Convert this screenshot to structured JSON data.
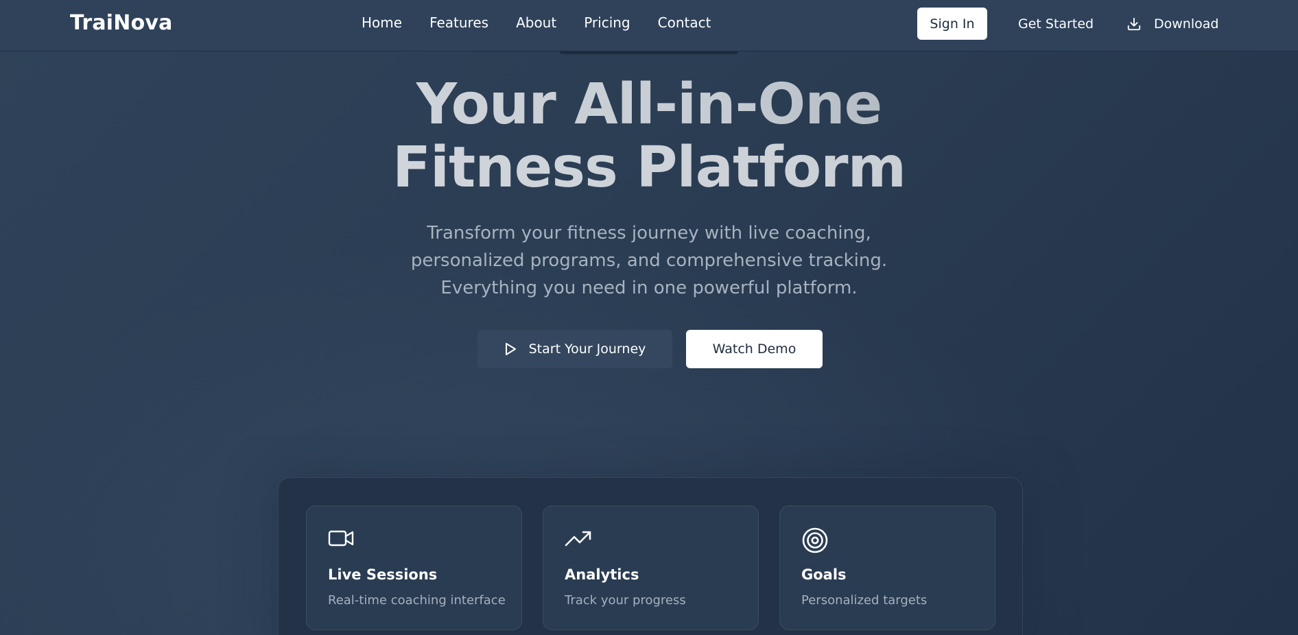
{
  "header": {
    "brand": "TraiNova",
    "nav": [
      {
        "label": "Home"
      },
      {
        "label": "Features"
      },
      {
        "label": "About"
      },
      {
        "label": "Pricing"
      },
      {
        "label": "Contact"
      }
    ],
    "sign_in_label": "Sign In",
    "get_started_label": "Get Started",
    "download_label": "Download",
    "download_icon": "download-icon"
  },
  "hero": {
    "title_line1": "Your All-in-One",
    "title_line2": "Fitness Platform",
    "subtitle": "Transform your fitness journey with live coaching, personalized programs, and comprehensive tracking. Everything you need in one powerful platform.",
    "primary_cta": {
      "label": "Start Your Journey",
      "icon": "play-icon"
    },
    "secondary_cta": {
      "label": "Watch Demo"
    }
  },
  "features": [
    {
      "icon": "video-camera-icon",
      "title": "Live Sessions",
      "description": "Real-time coaching interface"
    },
    {
      "icon": "trending-up-icon",
      "title": "Analytics",
      "description": "Track your progress"
    },
    {
      "icon": "target-icon",
      "title": "Goals",
      "description": "Personalized targets"
    }
  ],
  "colors": {
    "background": "#2c3e55",
    "header": "#2f425a",
    "panel": "#233247",
    "card": "#2a3c52",
    "subtitle_text": "#a8b3c0",
    "button_light": "#ffffff",
    "button_dark": "#34475f"
  }
}
